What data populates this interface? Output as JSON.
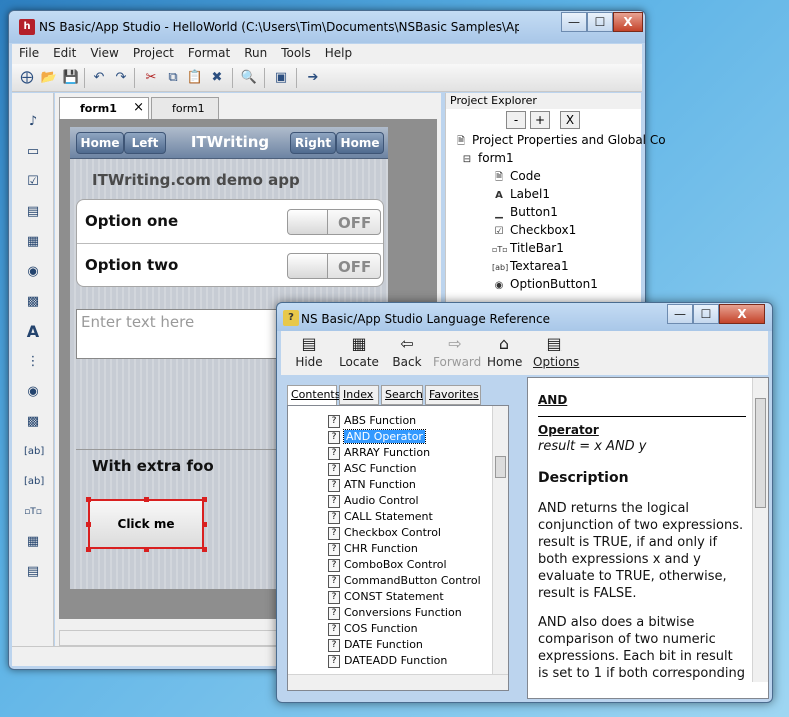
{
  "main_window": {
    "title": "NS Basic/App Studio - HelloWorld (C:\\Users\\Tim\\Documents\\NSBasic Samples\\App Studio\\...",
    "caption_buttons": {
      "minimize": "—",
      "maximize": "☐",
      "close": "X"
    },
    "menu": [
      "File",
      "Edit",
      "View",
      "Project",
      "Format",
      "Run",
      "Tools",
      "Help"
    ],
    "toolbar_icons": [
      "new-file-icon",
      "open-icon",
      "save-icon",
      "undo-icon",
      "redo-icon",
      "cut-icon",
      "copy-icon",
      "paste-icon",
      "delete-icon",
      "find-icon",
      "window-icon",
      "run-icon"
    ],
    "tabs": [
      {
        "label": "form1",
        "active": true
      },
      {
        "label": "form1",
        "active": false
      }
    ],
    "tab_close": "×"
  },
  "design": {
    "nav": {
      "home_left": "Home",
      "left": "Left",
      "title": "ITWriting",
      "right": "Right",
      "home_right": "Home"
    },
    "subtitle": "ITWriting.com demo app",
    "options": [
      {
        "label": "Option one",
        "state": "OFF"
      },
      {
        "label": "Option two",
        "state": "OFF"
      }
    ],
    "textarea_placeholder": "Enter text here",
    "footer": "With extra foo",
    "button": "Click me"
  },
  "explorer": {
    "title": "Project Explorer",
    "buttons": [
      "-",
      "+",
      "X"
    ],
    "tree": [
      {
        "label": "Project Properties and Global Co",
        "icon": "document-icon",
        "level": 0
      },
      {
        "label": "form1",
        "icon": "form-icon",
        "level": 1
      },
      {
        "label": "Code",
        "icon": "code-icon",
        "level": 2
      },
      {
        "label": "Label1",
        "icon": "label-icon",
        "level": 2
      },
      {
        "label": "Button1",
        "icon": "button-icon",
        "level": 2
      },
      {
        "label": "Checkbox1",
        "icon": "checkbox-icon",
        "level": 2
      },
      {
        "label": "TitleBar1",
        "icon": "titlebar-icon",
        "level": 2
      },
      {
        "label": "Textarea1",
        "icon": "textarea-icon",
        "level": 2
      },
      {
        "label": "OptionButton1",
        "icon": "radio-icon",
        "level": 2
      }
    ]
  },
  "help_window": {
    "title": "NS Basic/App Studio Language Reference",
    "toolbar": [
      {
        "label": "Hide",
        "icon": "hide-icon",
        "enabled": true
      },
      {
        "label": "Locate",
        "icon": "locate-icon",
        "enabled": true
      },
      {
        "label": "Back",
        "icon": "back-arrow-icon",
        "enabled": true
      },
      {
        "label": "Forward",
        "icon": "forward-arrow-icon",
        "enabled": false
      },
      {
        "label": "Home",
        "icon": "home-icon",
        "enabled": true
      },
      {
        "label": "Options",
        "icon": "options-icon",
        "enabled": true
      }
    ],
    "tabs": [
      "Contents",
      "Index",
      "Search",
      "Favorites"
    ],
    "topics": [
      "ABS Function",
      "AND Operator",
      "ARRAY Function",
      "ASC Function",
      "ATN Function",
      "Audio Control",
      "CALL Statement",
      "Checkbox Control",
      "CHR Function",
      "ComboBox Control",
      "CommandButton Control",
      "CONST Statement",
      "Conversions Function",
      "COS Function",
      "DATE Function",
      "DATEADD Function"
    ],
    "selected_topic": "AND Operator",
    "content": {
      "heading": "AND",
      "kind": "Operator",
      "syntax": "result = x AND y",
      "desc_heading": "Description",
      "para1": "AND returns the logical conjunction of two expressions. result is TRUE, if and only if both expressions x and y evaluate to TRUE, otherwise, result is FALSE.",
      "para2": "AND also does a bitwise comparison of two numeric expressions. Each bit in result is set to 1 if both corresponding"
    }
  },
  "colors": {
    "selection": "#3399ff",
    "handle": "#d92020",
    "nav": "#6d84a3"
  }
}
